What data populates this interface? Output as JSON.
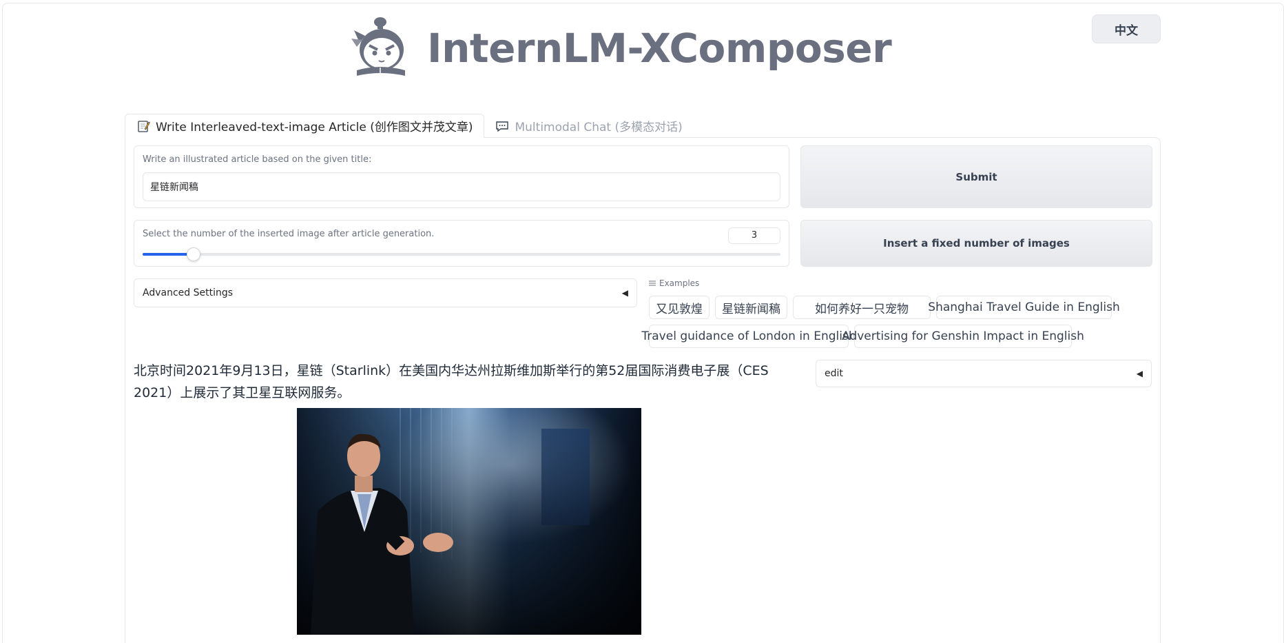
{
  "header": {
    "app_title": "InternLM-XComposer",
    "language_button": "中文"
  },
  "tabs": [
    {
      "label": "Write Interleaved-text-image Article (创作图文并茂文章)",
      "icon": "memo-icon",
      "active": true
    },
    {
      "label": "Multimodal Chat (多模态对话)",
      "icon": "chat-bubble-icon",
      "active": false
    }
  ],
  "title_field": {
    "label": "Write an illustrated article based on the given title:",
    "value": "星链新闻稿"
  },
  "image_count": {
    "label": "Select the number of the inserted image after article generation.",
    "value": "3",
    "fraction": 0.08
  },
  "buttons": {
    "submit": "Submit",
    "insert_fixed": "Insert a fixed number of images"
  },
  "advanced_settings": {
    "label": "Advanced Settings",
    "caret": "◀"
  },
  "examples": {
    "label": "Examples",
    "items": [
      "又见敦煌",
      "星链新闻稿",
      "如何养好一只宠物",
      "Shanghai Travel Guide in English",
      "Travel guidance of London in English",
      "Advertising for Genshin Impact in English"
    ]
  },
  "article": {
    "text": "北京时间2021年9月13日，星链（Starlink）在美国内华达州拉斯维加斯举行的第52届国际消费电子展（CES 2021）上展示了其卫星互联网服务。"
  },
  "edit_panel": {
    "label": "edit",
    "caret": "◀"
  },
  "colors": {
    "accent": "#2563eb",
    "title_gray": "#6b7080",
    "border": "#e5e7eb"
  }
}
